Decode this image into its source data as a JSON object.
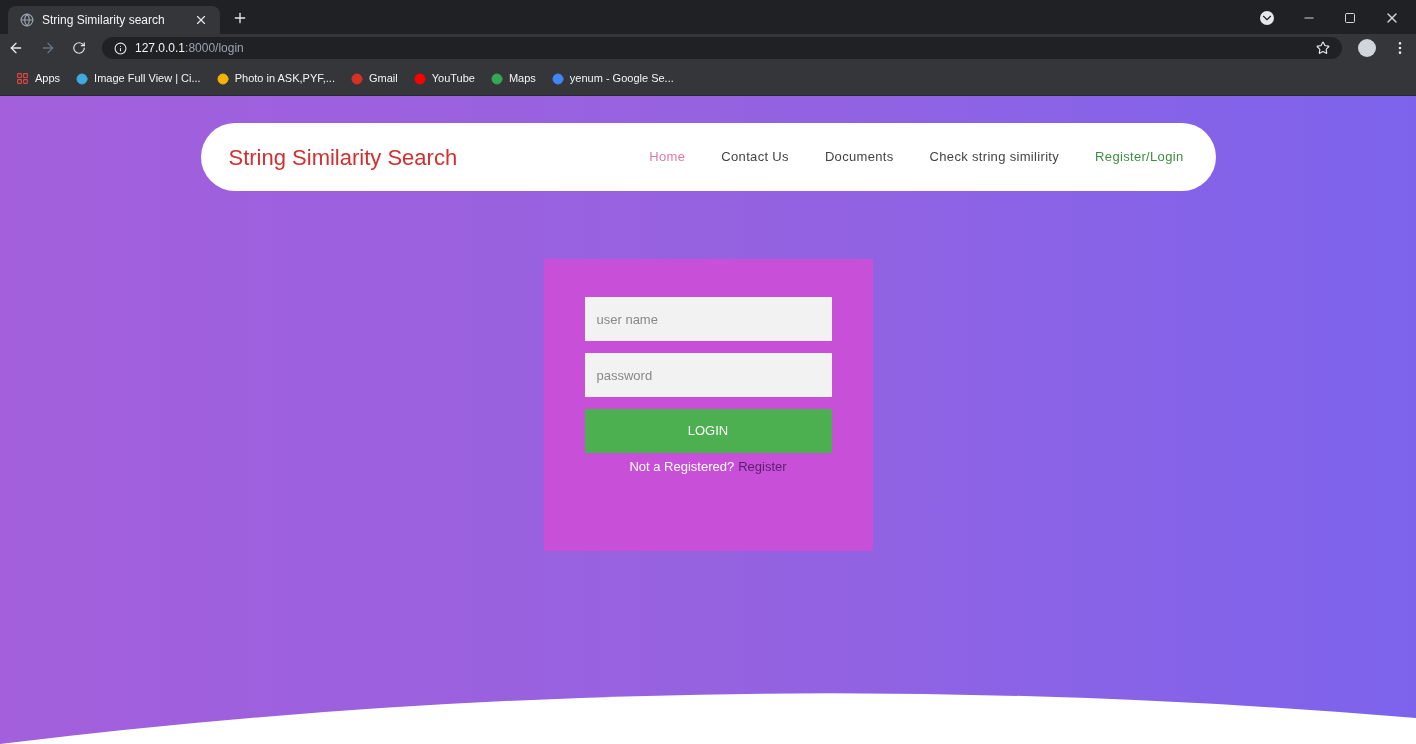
{
  "browser": {
    "tab": {
      "title": "String Similarity search"
    },
    "url": {
      "host": "127.0.0.1",
      "path": ":8000/login"
    },
    "bookmarks": [
      {
        "label": "Apps",
        "color": "#e8453c"
      },
      {
        "label": "Image Full View | Ci...",
        "color": "#3fa9e0"
      },
      {
        "label": "Photo in ASK,PYF,...",
        "color": "#f4b400"
      },
      {
        "label": "Gmail",
        "color": "#d93025"
      },
      {
        "label": "YouTube",
        "color": "#ff0000"
      },
      {
        "label": "Maps",
        "color": "#34a853"
      },
      {
        "label": "yenum - Google Se...",
        "color": "#4285f4"
      }
    ]
  },
  "navbar": {
    "brand": "String Similarity Search",
    "items": [
      {
        "label": "Home",
        "color": "#e27aa6"
      },
      {
        "label": "Contact Us",
        "color": "#444444"
      },
      {
        "label": "Documents",
        "color": "#444444"
      },
      {
        "label": "Check string similirity",
        "color": "#444444"
      },
      {
        "label": "Register/Login",
        "color": "#3e8e41"
      }
    ]
  },
  "login": {
    "username": {
      "placeholder": "user name"
    },
    "password": {
      "placeholder": "password"
    },
    "button": "LOGIN",
    "prompt": "Not a Registered?",
    "register_link": "Register"
  }
}
